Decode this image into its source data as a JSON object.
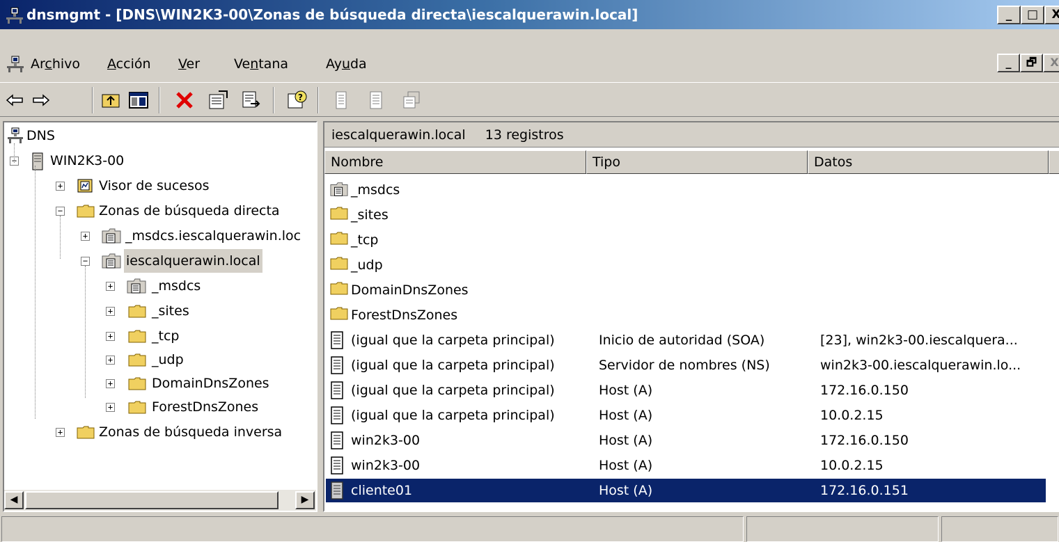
{
  "window": {
    "title": "dnsmgmt - [DNS\\WIN2K3-00\\Zonas de búsqueda directa\\iescalquerawin.local]",
    "minimize_label": "_",
    "maximize_label": "□",
    "close_label": "X"
  },
  "menubar": {
    "items": [
      {
        "pre": "Ar",
        "acc": "c",
        "post": "hivo"
      },
      {
        "pre": "",
        "acc": "A",
        "post": "cción"
      },
      {
        "pre": "",
        "acc": "V",
        "post": "er"
      },
      {
        "pre": "Ve",
        "acc": "n",
        "post": "tana"
      },
      {
        "pre": "Ay",
        "acc": "u",
        "post": "da"
      }
    ],
    "mdi_minimize": "_",
    "mdi_restore": "🗗",
    "mdi_close": "X"
  },
  "toolbar": {
    "icons": [
      "back-icon",
      "forward-icon",
      "up-folder-icon",
      "show-hide-tree-icon",
      "delete-icon",
      "properties-icon",
      "export-list-icon",
      "help-icon",
      "new-record-icon",
      "new-record-2-icon",
      "new-zone-icon"
    ]
  },
  "tree": {
    "root": "DNS",
    "server": "WIN2K3-00",
    "items": [
      {
        "label": "Visor de sucesos",
        "level": 2,
        "expander": "+",
        "icon": "event-viewer-icon"
      },
      {
        "label": "Zonas de búsqueda directa",
        "level": 2,
        "expander": "−",
        "icon": "folder-icon"
      },
      {
        "label": "_msdcs.iescalquerawin.loc",
        "level": 3,
        "expander": "+",
        "icon": "zone-icon"
      },
      {
        "label": "iescalquerawin.local",
        "level": 3,
        "expander": "−",
        "icon": "zone-icon",
        "selected": true
      },
      {
        "label": "_msdcs",
        "level": 4,
        "expander": "+",
        "icon": "zone-icon"
      },
      {
        "label": "_sites",
        "level": 4,
        "expander": "+",
        "icon": "folder-icon"
      },
      {
        "label": "_tcp",
        "level": 4,
        "expander": "+",
        "icon": "folder-icon"
      },
      {
        "label": "_udp",
        "level": 4,
        "expander": "+",
        "icon": "folder-icon"
      },
      {
        "label": "DomainDnsZones",
        "level": 4,
        "expander": "+",
        "icon": "folder-icon"
      },
      {
        "label": "ForestDnsZones",
        "level": 4,
        "expander": "+",
        "icon": "folder-icon"
      },
      {
        "label": "Zonas de búsqueda inversa",
        "level": 2,
        "expander": "+",
        "icon": "folder-icon"
      }
    ]
  },
  "list": {
    "zone_name": "iescalquerawin.local",
    "record_count": "13 registros",
    "columns": [
      "Nombre",
      "Tipo",
      "Datos"
    ],
    "rows": [
      {
        "name": "_msdcs",
        "type": "",
        "data": "",
        "icon": "zone-icon"
      },
      {
        "name": "_sites",
        "type": "",
        "data": "",
        "icon": "folder-icon"
      },
      {
        "name": "_tcp",
        "type": "",
        "data": "",
        "icon": "folder-icon"
      },
      {
        "name": "_udp",
        "type": "",
        "data": "",
        "icon": "folder-icon"
      },
      {
        "name": "DomainDnsZones",
        "type": "",
        "data": "",
        "icon": "folder-icon"
      },
      {
        "name": "ForestDnsZones",
        "type": "",
        "data": "",
        "icon": "folder-icon"
      },
      {
        "name": "(igual que la carpeta principal)",
        "type": "Inicio de autoridad (SOA)",
        "data": "[23], win2k3-00.iescalquera...",
        "icon": "record-icon"
      },
      {
        "name": "(igual que la carpeta principal)",
        "type": "Servidor de nombres (NS)",
        "data": "win2k3-00.iescalquerawin.lo...",
        "icon": "record-icon"
      },
      {
        "name": "(igual que la carpeta principal)",
        "type": "Host (A)",
        "data": "172.16.0.150",
        "icon": "record-icon"
      },
      {
        "name": "(igual que la carpeta principal)",
        "type": "Host (A)",
        "data": "10.0.2.15",
        "icon": "record-icon"
      },
      {
        "name": "win2k3-00",
        "type": "Host (A)",
        "data": "172.16.0.150",
        "icon": "record-icon"
      },
      {
        "name": "win2k3-00",
        "type": "Host (A)",
        "data": "10.0.2.15",
        "icon": "record-icon"
      },
      {
        "name": "cliente01",
        "type": "Host (A)",
        "data": "172.16.0.151",
        "icon": "record-icon",
        "selected": true
      }
    ]
  },
  "colors": {
    "title_active_start": "#0a246a",
    "title_active_end": "#a6caf0",
    "selection": "#0a246a",
    "face": "#d4d0c8",
    "folder": "#f0d060"
  }
}
